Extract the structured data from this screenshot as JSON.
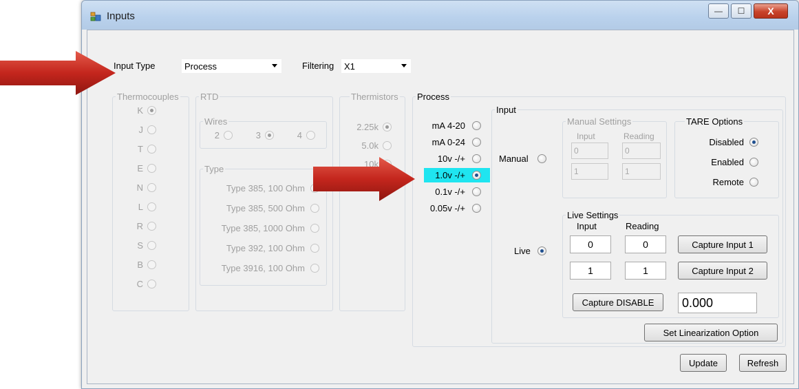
{
  "window": {
    "title": "Inputs",
    "min_glyph": "—",
    "max_glyph": "☐",
    "close_glyph": "X"
  },
  "header": {
    "input_type_label": "Input Type",
    "input_type_value": "Process",
    "filtering_label": "Filtering",
    "filtering_value": "X1"
  },
  "thermocouples": {
    "title": "Thermocouples",
    "items": [
      {
        "label": "K",
        "checked": true
      },
      {
        "label": "J",
        "checked": false
      },
      {
        "label": "T",
        "checked": false
      },
      {
        "label": "E",
        "checked": false
      },
      {
        "label": "N",
        "checked": false
      },
      {
        "label": "L",
        "checked": false
      },
      {
        "label": "R",
        "checked": false
      },
      {
        "label": "S",
        "checked": false
      },
      {
        "label": "B",
        "checked": false
      },
      {
        "label": "C",
        "checked": false
      }
    ]
  },
  "rtd": {
    "title": "RTD",
    "wires_title": "Wires",
    "wires": [
      {
        "label": "2",
        "checked": false
      },
      {
        "label": "3",
        "checked": true
      },
      {
        "label": "4",
        "checked": false
      }
    ],
    "type_title": "Type",
    "types": [
      {
        "label": "Type 385,  100 Ohm",
        "checked": true
      },
      {
        "label": "Type 385,  500 Ohm",
        "checked": false
      },
      {
        "label": "Type 385,  1000 Ohm",
        "checked": false
      },
      {
        "label": "Type 392,  100 Ohm",
        "checked": false
      },
      {
        "label": "Type 3916,  100 Ohm",
        "checked": false
      }
    ]
  },
  "thermistors": {
    "title": "Thermistors",
    "items": [
      {
        "label": "2.25k",
        "checked": true
      },
      {
        "label": "5.0k",
        "checked": false
      },
      {
        "label": "10k",
        "checked": false
      }
    ]
  },
  "process": {
    "title": "Process",
    "items": [
      {
        "label": "mA 4-20",
        "checked": false,
        "highlight": false
      },
      {
        "label": "mA 0-24",
        "checked": false,
        "highlight": false
      },
      {
        "label": "10v -/+",
        "checked": false,
        "highlight": false
      },
      {
        "label": "1.0v -/+",
        "checked": true,
        "highlight": true
      },
      {
        "label": "0.1v -/+",
        "checked": false,
        "highlight": false
      },
      {
        "label": "0.05v -/+",
        "checked": false,
        "highlight": false
      }
    ],
    "highlight_color": "#1fe5f0"
  },
  "input": {
    "title": "Input",
    "manual_label": "Manual",
    "manual_checked": false,
    "live_label": "Live",
    "live_checked": true,
    "manual_settings": {
      "title": "Manual Settings",
      "input_header": "Input",
      "reading_header": "Reading",
      "rows": [
        {
          "input": "0",
          "reading": "0"
        },
        {
          "input": "1",
          "reading": "1"
        }
      ]
    },
    "tare": {
      "title": "TARE Options",
      "options": [
        {
          "label": "Disabled",
          "checked": true
        },
        {
          "label": "Enabled",
          "checked": false
        },
        {
          "label": "Remote",
          "checked": false
        }
      ]
    },
    "live_settings": {
      "title": "Live Settings",
      "input_header": "Input",
      "reading_header": "Reading",
      "rows": [
        {
          "input": "0",
          "reading": "0"
        },
        {
          "input": "1",
          "reading": "1"
        }
      ],
      "capture_input_1": "Capture Input 1",
      "capture_input_2": "Capture Input 2",
      "capture_disable": "Capture DISABLE",
      "value": "0.000"
    },
    "set_linearization": "Set Linearization Option"
  },
  "footer": {
    "update": "Update",
    "refresh": "Refresh"
  },
  "colors": {
    "arrow_red": "#c4261d",
    "selection_cyan": "#1fe5f0"
  }
}
